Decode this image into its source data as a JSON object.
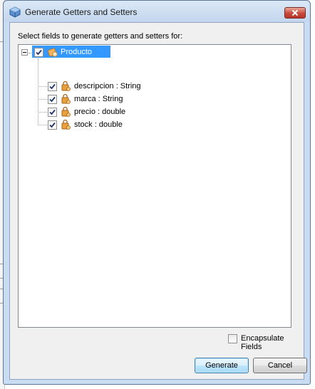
{
  "window": {
    "title": "Generate Getters and Setters"
  },
  "prompt": "Select fields to generate getters and setters for:",
  "tree": {
    "root": {
      "label": "Producto",
      "checked": true,
      "expanded": true,
      "selected": true
    },
    "fields": [
      {
        "label": "descripcion : String",
        "checked": true
      },
      {
        "label": "marca : String",
        "checked": true
      },
      {
        "label": "precio : double",
        "checked": true
      },
      {
        "label": "stock : double",
        "checked": true
      }
    ]
  },
  "options": {
    "encapsulate_label": "Encapsulate Fields",
    "encapsulate_checked": false
  },
  "buttons": {
    "generate": "Generate",
    "cancel": "Cancel"
  },
  "colors": {
    "selection": "#3399ff",
    "dialog_bg": "#f0f0f0",
    "frame": "#c9dcf2",
    "close": "#c8493a"
  }
}
